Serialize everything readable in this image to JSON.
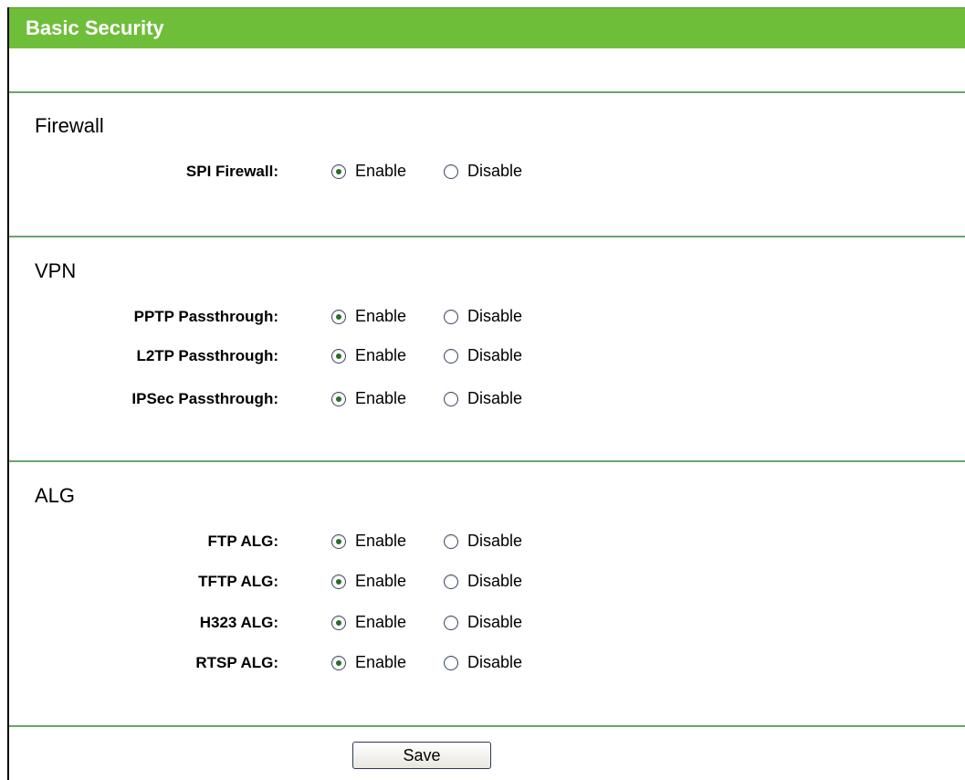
{
  "header": {
    "title": "Basic Security"
  },
  "options": {
    "enable": "Enable",
    "disable": "Disable"
  },
  "sections": [
    {
      "title": "Firewall",
      "rows": [
        {
          "label": "SPI Firewall:",
          "selected": "Enable"
        }
      ]
    },
    {
      "title": "VPN",
      "rows": [
        {
          "label": "PPTP Passthrough:",
          "selected": "Enable"
        },
        {
          "label": "L2TP Passthrough:",
          "selected": "Enable"
        },
        {
          "label": "IPSec Passthrough:",
          "selected": "Enable"
        }
      ]
    },
    {
      "title": "ALG",
      "rows": [
        {
          "label": "FTP ALG:",
          "selected": "Enable"
        },
        {
          "label": "TFTP ALG:",
          "selected": "Enable"
        },
        {
          "label": "H323 ALG:",
          "selected": "Enable"
        },
        {
          "label": "RTSP ALG:",
          "selected": "Enable"
        }
      ]
    }
  ],
  "actions": {
    "save_label": "Save"
  },
  "colors": {
    "header_bg": "#6fbe3a",
    "divider": "#6aa56a"
  }
}
